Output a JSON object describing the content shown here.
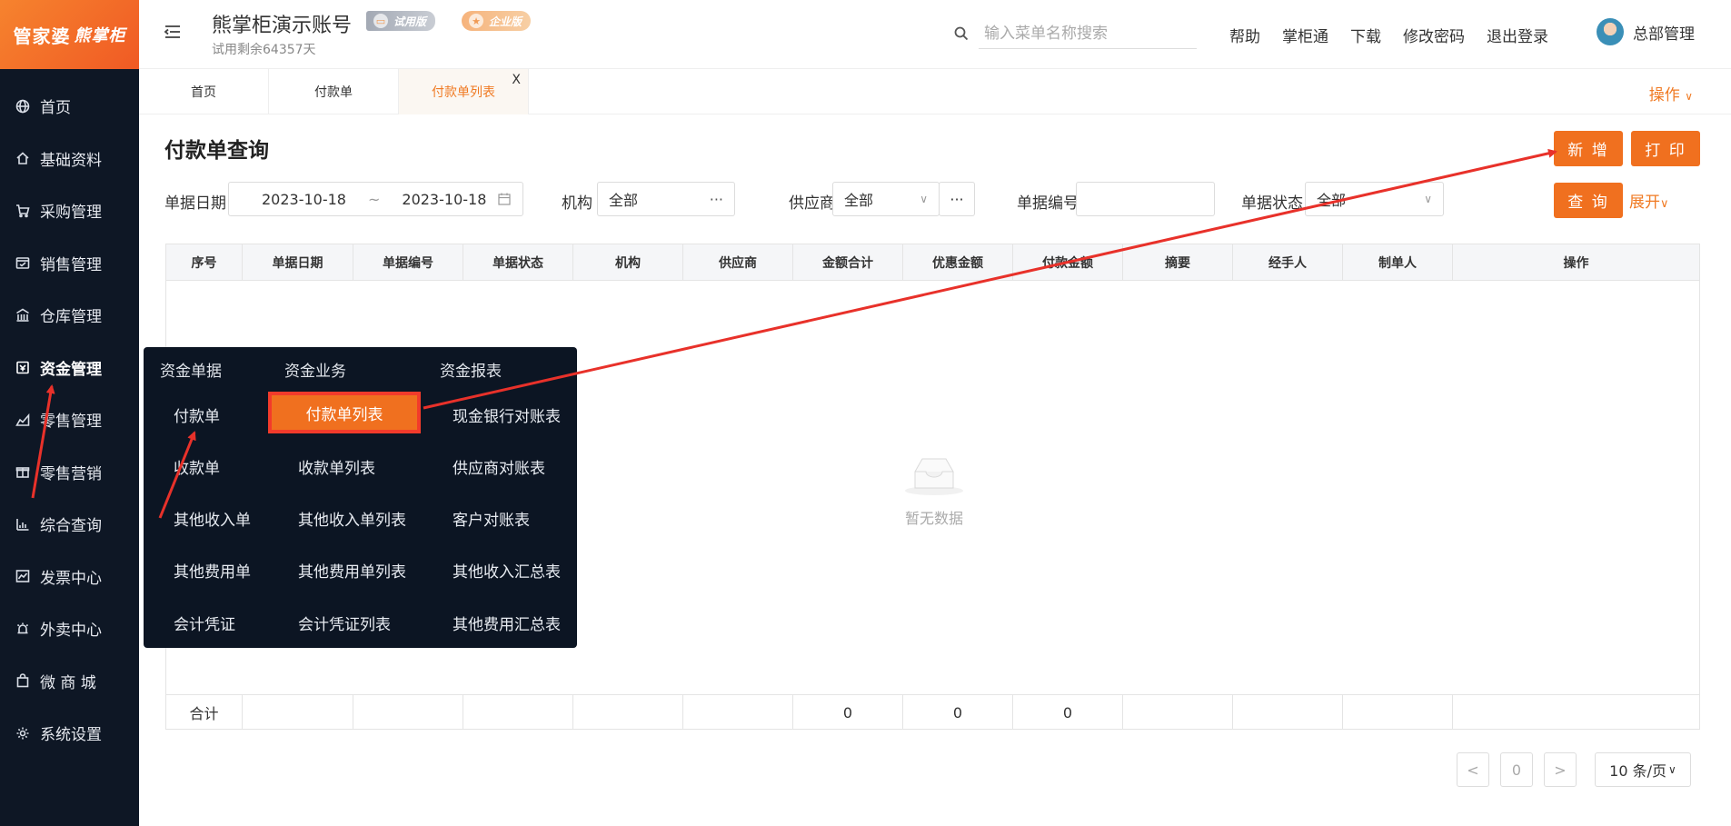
{
  "app": {
    "logo_text_a": "管家婆",
    "logo_text_b": "熊掌柜",
    "account_name": "熊掌柜演示账号",
    "trial_badge": "试用版",
    "ent_badge": "企业版",
    "trial_remaining": "试用剩余64357天"
  },
  "header": {
    "search_placeholder": "输入菜单名称搜索",
    "links": [
      "帮助",
      "掌柜通",
      "下载",
      "修改密码",
      "退出登录"
    ],
    "user_name": "总部管理"
  },
  "sidebar": {
    "items": [
      {
        "label": "首页",
        "icon": "globe-icon"
      },
      {
        "label": "基础资料",
        "icon": "home-icon"
      },
      {
        "label": "采购管理",
        "icon": "cart-icon"
      },
      {
        "label": "销售管理",
        "icon": "sales-icon"
      },
      {
        "label": "仓库管理",
        "icon": "warehouse-icon"
      },
      {
        "label": "资金管理",
        "icon": "wallet-icon"
      },
      {
        "label": "零售管理",
        "icon": "chart-area-icon"
      },
      {
        "label": "零售营销",
        "icon": "gift-icon"
      },
      {
        "label": "综合查询",
        "icon": "bar-chart-icon"
      },
      {
        "label": "发票中心",
        "icon": "invoice-icon"
      },
      {
        "label": "外卖中心",
        "icon": "alarm-icon"
      },
      {
        "label": "微 商 城",
        "icon": "bag-icon"
      },
      {
        "label": "系统设置",
        "icon": "gear-icon"
      }
    ],
    "active_index": 5
  },
  "tabs": {
    "items": [
      "首页",
      "付款单",
      "付款单列表"
    ],
    "active_index": 2,
    "close_symbol": "X",
    "ops_label": "操作"
  },
  "page": {
    "title": "付款单查询",
    "add_button": "新 增",
    "print_button": "打 印",
    "query_button": "查 询",
    "expand_label": "展开",
    "filters": {
      "date_label": "单据日期",
      "date_from": "2023-10-18",
      "date_sep": "~",
      "date_to": "2023-10-18",
      "org_label": "机构",
      "org_value": "全部",
      "supplier_label": "供应商",
      "supplier_value": "全部",
      "docno_label": "单据编号",
      "docno_value": "",
      "status_label": "单据状态",
      "status_value": "全部"
    }
  },
  "table": {
    "columns": [
      "序号",
      "单据日期",
      "单据编号",
      "单据状态",
      "机构",
      "供应商",
      "金额合计",
      "优惠金额",
      "付款金额",
      "摘要",
      "经手人",
      "制单人",
      "操作"
    ],
    "empty_text": "暂无数据",
    "footer": [
      "合计",
      "",
      "",
      "",
      "",
      "",
      "0",
      "0",
      "0",
      "",
      "",
      "",
      ""
    ]
  },
  "pagination": {
    "prev": "<",
    "current": "0",
    "next": ">",
    "page_size": "10 条/页"
  },
  "flyout": {
    "headers": [
      "资金单据",
      "资金业务",
      "资金报表"
    ],
    "col1": [
      "付款单",
      "收款单",
      "其他收入单",
      "其他费用单",
      "会计凭证"
    ],
    "col2": [
      "付款单列表",
      "收款单列表",
      "其他收入单列表",
      "其他费用单列表",
      "会计凭证列表"
    ],
    "col3": [
      "现金银行对账表",
      "供应商对账表",
      "客户对账表",
      "其他收入汇总表",
      "其他费用汇总表"
    ]
  },
  "colors": {
    "accent": "#f0701f",
    "sidebar_bg": "#0e1725",
    "arrow": "#e8312a"
  }
}
